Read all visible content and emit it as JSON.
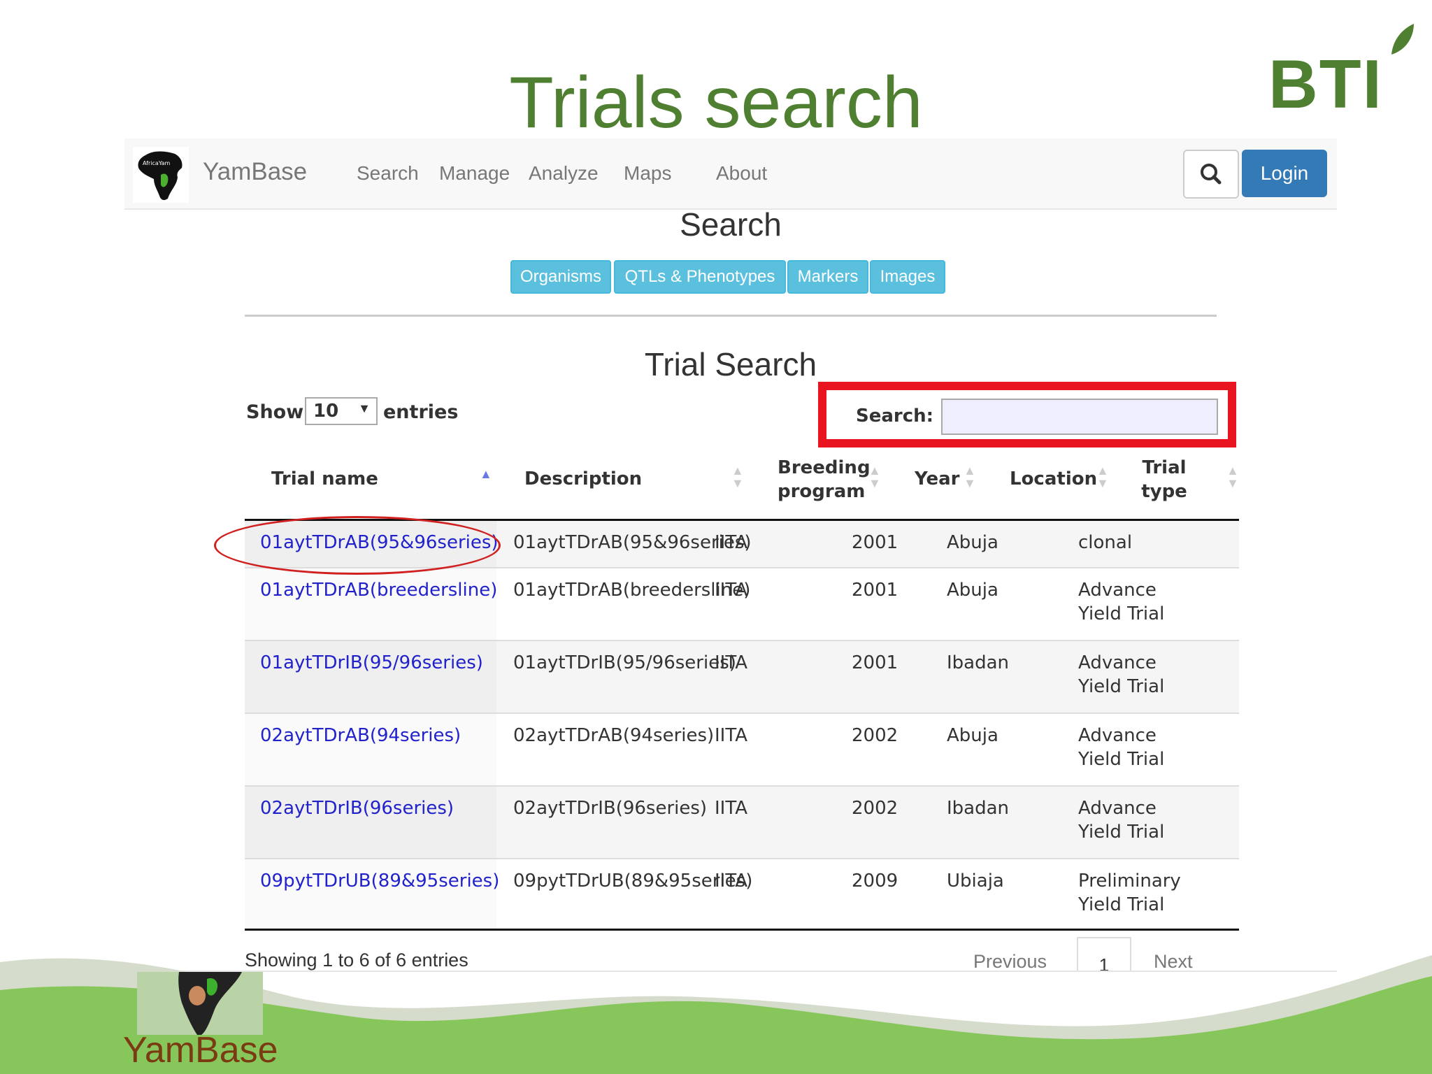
{
  "slide": {
    "title": "Trials search",
    "logo_text": "BTI",
    "caption": "YamBase"
  },
  "navbar": {
    "logo_text": "AfricaYam",
    "brand": "YamBase",
    "items": [
      "Search",
      "Manage",
      "Analyze",
      "Maps",
      "About"
    ],
    "search_icon": "search-icon",
    "login_label": "Login"
  },
  "page": {
    "heading": "Search",
    "tabs": [
      "Organisms",
      "QTLs & Phenotypes",
      "Markers",
      "Images"
    ],
    "section_heading": "Trial Search"
  },
  "table_controls": {
    "show_label": "Show",
    "page_size": "10",
    "entries_label": "entries",
    "search_label": "Search:",
    "search_value": ""
  },
  "table": {
    "columns": [
      {
        "label": "Trial name"
      },
      {
        "label": "Description"
      },
      {
        "label": "Breeding program"
      },
      {
        "label": "Year"
      },
      {
        "label": "Location"
      },
      {
        "label": "Trial type"
      }
    ],
    "rows": [
      {
        "name": "01aytTDrAB(95&96series)",
        "description": "01aytTDrAB(95&96series)",
        "program": "IITA",
        "year": "2001",
        "location": "Abuja",
        "type": "clonal"
      },
      {
        "name": "01aytTDrAB(breedersline)",
        "description": "01aytTDrAB(breedersline)",
        "program": "IITA",
        "year": "2001",
        "location": "Abuja",
        "type": "Advance Yield Trial"
      },
      {
        "name": "01aytTDrIB(95/96series)",
        "description": "01aytTDrIB(95/96series)",
        "program": "IITA",
        "year": "2001",
        "location": "Ibadan",
        "type": "Advance Yield Trial"
      },
      {
        "name": "02aytTDrAB(94series)",
        "description": "02aytTDrAB(94series)",
        "program": "IITA",
        "year": "2002",
        "location": "Abuja",
        "type": "Advance Yield Trial"
      },
      {
        "name": "02aytTDrIB(96series)",
        "description": "02aytTDrIB(96series)",
        "program": "IITA",
        "year": "2002",
        "location": "Ibadan",
        "type": "Advance Yield Trial"
      },
      {
        "name": "09pytTDrUB(89&95series)",
        "description": "09pytTDrUB(89&95series)",
        "program": "IITA",
        "year": "2009",
        "location": "Ubiaja",
        "type": "Preliminary Yield Trial"
      }
    ]
  },
  "pagination": {
    "summary": "Showing 1 to 6 of 6 entries",
    "previous": "Previous",
    "current_page": "1",
    "next": "Next"
  },
  "colors": {
    "title_green": "#4f7f30",
    "highlight_red": "#e8141f",
    "link_blue": "#2222cc",
    "tab_blue": "#5bc0de",
    "login_blue": "#337ab7",
    "footer_green": "#86c65b"
  }
}
